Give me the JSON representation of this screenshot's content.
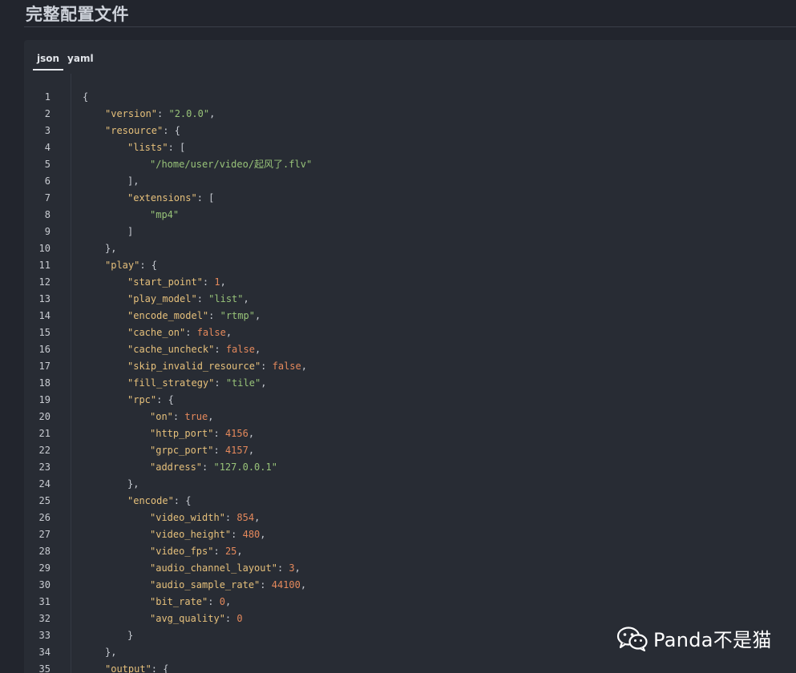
{
  "page": {
    "title": "完整配置文件"
  },
  "tabs": [
    {
      "label": "json",
      "active": true
    },
    {
      "label": "yaml",
      "active": false
    }
  ],
  "colors": {
    "background": "#22252d",
    "panel": "#282c34",
    "key": "#e6c07b",
    "string": "#98c379",
    "number": "#e5895c",
    "punctuation": "#c7cbd2"
  },
  "code": {
    "language": "json",
    "lines": [
      {
        "n": "1",
        "indent": 0,
        "tokens": [
          [
            "p",
            "{"
          ]
        ]
      },
      {
        "n": "2",
        "indent": 1,
        "tokens": [
          [
            "k",
            "\"version\""
          ],
          [
            "p",
            ": "
          ],
          [
            "s",
            "\"2.0.0\""
          ],
          [
            "p",
            ","
          ]
        ]
      },
      {
        "n": "3",
        "indent": 1,
        "tokens": [
          [
            "k",
            "\"resource\""
          ],
          [
            "p",
            ": {"
          ]
        ]
      },
      {
        "n": "4",
        "indent": 2,
        "tokens": [
          [
            "k",
            "\"lists\""
          ],
          [
            "p",
            ": ["
          ]
        ]
      },
      {
        "n": "5",
        "indent": 3,
        "tokens": [
          [
            "s",
            "\"/home/user/video/起风了.flv\""
          ]
        ]
      },
      {
        "n": "6",
        "indent": 2,
        "tokens": [
          [
            "p",
            "],"
          ]
        ]
      },
      {
        "n": "7",
        "indent": 2,
        "tokens": [
          [
            "k",
            "\"extensions\""
          ],
          [
            "p",
            ": ["
          ]
        ]
      },
      {
        "n": "8",
        "indent": 3,
        "tokens": [
          [
            "s",
            "\"mp4\""
          ]
        ]
      },
      {
        "n": "9",
        "indent": 2,
        "tokens": [
          [
            "p",
            "]"
          ]
        ]
      },
      {
        "n": "10",
        "indent": 1,
        "tokens": [
          [
            "p",
            "},"
          ]
        ]
      },
      {
        "n": "11",
        "indent": 1,
        "tokens": [
          [
            "k",
            "\"play\""
          ],
          [
            "p",
            ": {"
          ]
        ]
      },
      {
        "n": "12",
        "indent": 2,
        "tokens": [
          [
            "k",
            "\"start_point\""
          ],
          [
            "p",
            ": "
          ],
          [
            "n",
            "1"
          ],
          [
            "p",
            ","
          ]
        ]
      },
      {
        "n": "13",
        "indent": 2,
        "tokens": [
          [
            "k",
            "\"play_model\""
          ],
          [
            "p",
            ": "
          ],
          [
            "s",
            "\"list\""
          ],
          [
            "p",
            ","
          ]
        ]
      },
      {
        "n": "14",
        "indent": 2,
        "tokens": [
          [
            "k",
            "\"encode_model\""
          ],
          [
            "p",
            ": "
          ],
          [
            "s",
            "\"rtmp\""
          ],
          [
            "p",
            ","
          ]
        ]
      },
      {
        "n": "15",
        "indent": 2,
        "tokens": [
          [
            "k",
            "\"cache_on\""
          ],
          [
            "p",
            ": "
          ],
          [
            "b",
            "false"
          ],
          [
            "p",
            ","
          ]
        ]
      },
      {
        "n": "16",
        "indent": 2,
        "tokens": [
          [
            "k",
            "\"cache_uncheck\""
          ],
          [
            "p",
            ": "
          ],
          [
            "b",
            "false"
          ],
          [
            "p",
            ","
          ]
        ]
      },
      {
        "n": "17",
        "indent": 2,
        "tokens": [
          [
            "k",
            "\"skip_invalid_resource\""
          ],
          [
            "p",
            ": "
          ],
          [
            "b",
            "false"
          ],
          [
            "p",
            ","
          ]
        ]
      },
      {
        "n": "18",
        "indent": 2,
        "tokens": [
          [
            "k",
            "\"fill_strategy\""
          ],
          [
            "p",
            ": "
          ],
          [
            "s",
            "\"tile\""
          ],
          [
            "p",
            ","
          ]
        ]
      },
      {
        "n": "19",
        "indent": 2,
        "tokens": [
          [
            "k",
            "\"rpc\""
          ],
          [
            "p",
            ": {"
          ]
        ]
      },
      {
        "n": "20",
        "indent": 3,
        "tokens": [
          [
            "k",
            "\"on\""
          ],
          [
            "p",
            ": "
          ],
          [
            "b",
            "true"
          ],
          [
            "p",
            ","
          ]
        ]
      },
      {
        "n": "21",
        "indent": 3,
        "tokens": [
          [
            "k",
            "\"http_port\""
          ],
          [
            "p",
            ": "
          ],
          [
            "n",
            "4156"
          ],
          [
            "p",
            ","
          ]
        ]
      },
      {
        "n": "22",
        "indent": 3,
        "tokens": [
          [
            "k",
            "\"grpc_port\""
          ],
          [
            "p",
            ": "
          ],
          [
            "n",
            "4157"
          ],
          [
            "p",
            ","
          ]
        ]
      },
      {
        "n": "23",
        "indent": 3,
        "tokens": [
          [
            "k",
            "\"address\""
          ],
          [
            "p",
            ": "
          ],
          [
            "s",
            "\"127.0.0.1\""
          ]
        ]
      },
      {
        "n": "24",
        "indent": 2,
        "tokens": [
          [
            "p",
            "},"
          ]
        ]
      },
      {
        "n": "25",
        "indent": 2,
        "tokens": [
          [
            "k",
            "\"encode\""
          ],
          [
            "p",
            ": {"
          ]
        ]
      },
      {
        "n": "26",
        "indent": 3,
        "tokens": [
          [
            "k",
            "\"video_width\""
          ],
          [
            "p",
            ": "
          ],
          [
            "n",
            "854"
          ],
          [
            "p",
            ","
          ]
        ]
      },
      {
        "n": "27",
        "indent": 3,
        "tokens": [
          [
            "k",
            "\"video_height\""
          ],
          [
            "p",
            ": "
          ],
          [
            "n",
            "480"
          ],
          [
            "p",
            ","
          ]
        ]
      },
      {
        "n": "28",
        "indent": 3,
        "tokens": [
          [
            "k",
            "\"video_fps\""
          ],
          [
            "p",
            ": "
          ],
          [
            "n",
            "25"
          ],
          [
            "p",
            ","
          ]
        ]
      },
      {
        "n": "29",
        "indent": 3,
        "tokens": [
          [
            "k",
            "\"audio_channel_layout\""
          ],
          [
            "p",
            ": "
          ],
          [
            "n",
            "3"
          ],
          [
            "p",
            ","
          ]
        ]
      },
      {
        "n": "30",
        "indent": 3,
        "tokens": [
          [
            "k",
            "\"audio_sample_rate\""
          ],
          [
            "p",
            ": "
          ],
          [
            "n",
            "44100"
          ],
          [
            "p",
            ","
          ]
        ]
      },
      {
        "n": "31",
        "indent": 3,
        "tokens": [
          [
            "k",
            "\"bit_rate\""
          ],
          [
            "p",
            ": "
          ],
          [
            "n",
            "0"
          ],
          [
            "p",
            ","
          ]
        ]
      },
      {
        "n": "32",
        "indent": 3,
        "tokens": [
          [
            "k",
            "\"avg_quality\""
          ],
          [
            "p",
            ": "
          ],
          [
            "n",
            "0"
          ]
        ]
      },
      {
        "n": "33",
        "indent": 2,
        "tokens": [
          [
            "p",
            "}"
          ]
        ]
      },
      {
        "n": "34",
        "indent": 1,
        "tokens": [
          [
            "p",
            "},"
          ]
        ]
      },
      {
        "n": "35",
        "indent": 1,
        "tokens": [
          [
            "k",
            "\"output\""
          ],
          [
            "p",
            ": {"
          ]
        ]
      }
    ]
  },
  "watermark": {
    "icon": "wechat-icon",
    "text": "Panda不是猫"
  }
}
